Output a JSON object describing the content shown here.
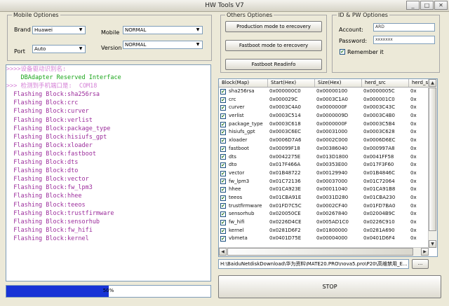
{
  "window": {
    "title": "HW Tools V7"
  },
  "mobile_options": {
    "legend": "Mobile Optiones",
    "brand_label": "Brand",
    "brand_value": "Huawei",
    "port_label": "Port",
    "port_value": "Auto",
    "mobile_label": "Mobile",
    "mobile_value": "NORMAL",
    "version_label": "Version",
    "version_value": "NORMAL"
  },
  "others_options": {
    "legend": "Others Optiones",
    "production_button": "Production mode to erecovery",
    "fastboot_button": "Fastboot mode to erecovery",
    "readinfo_button": "Fastboot Readinfo"
  },
  "id_pw_options": {
    "legend": "ID & PW Optiones",
    "account_label": "Account:",
    "account_value": "ARD",
    "password_label": "Password:",
    "password_value": "xxxxxxx",
    "remember_label": "Remember it",
    "remember_mark": "✔"
  },
  "log": {
    "lines": [
      {
        "text": ">>>>设备驱动识别名:",
        "color": "#d47fd6"
      },
      {
        "text": "    DBAdapter Reserved Interface",
        "color": "#19a519"
      },
      {
        "text": ">>> 检测到手机端口是:  COM18",
        "color": "#d47fd6"
      },
      {
        "text": "  Flashing Block:sha256rsa",
        "color": "#9b2c9b"
      },
      {
        "text": "  Flashing Block:crc",
        "color": "#9b2c9b"
      },
      {
        "text": "  Flashing Block:curver",
        "color": "#9b2c9b"
      },
      {
        "text": "  Flashing Block:verlist",
        "color": "#9b2c9b"
      },
      {
        "text": "  Flashing Block:package_type",
        "color": "#9b2c9b"
      },
      {
        "text": "  Flashing Block:hisiufs_gpt",
        "color": "#9b2c9b"
      },
      {
        "text": "  Flashing Block:xloader",
        "color": "#9b2c9b"
      },
      {
        "text": "  Flashing Block:fastboot",
        "color": "#9b2c9b"
      },
      {
        "text": "  Flashing Block:dts",
        "color": "#9b2c9b"
      },
      {
        "text": "  Flashing Block:dto",
        "color": "#9b2c9b"
      },
      {
        "text": "  Flashing Block:vector",
        "color": "#9b2c9b"
      },
      {
        "text": "  Flashing Block:fw_lpm3",
        "color": "#9b2c9b"
      },
      {
        "text": "  Flashing Block:hhee",
        "color": "#9b2c9b"
      },
      {
        "text": "  Flashing Block:teeos",
        "color": "#9b2c9b"
      },
      {
        "text": "  Flashing Block:trustfirmware",
        "color": "#9b2c9b"
      },
      {
        "text": "  Flashing Block:sensorhub",
        "color": "#9b2c9b"
      },
      {
        "text": "  Flashing Block:fw_hifi",
        "color": "#9b2c9b"
      },
      {
        "text": "  Flashing Block:kernel",
        "color": "#9b2c9b"
      }
    ]
  },
  "progress": {
    "value": 0.5,
    "label": "50%",
    "color": "#1833d6"
  },
  "table": {
    "headers": [
      "Block(Map)",
      "Start(Hex)",
      "Size(Hex)",
      "herd_src",
      "herd_sr"
    ],
    "check_mark": "✔",
    "rows": [
      [
        "sha256rsa",
        "0x000000C0",
        "0x00000100",
        "0x0000005C",
        "0x"
      ],
      [
        "crc",
        "0x000029C",
        "0x0003C1A0",
        "0x000001C0",
        "0x"
      ],
      [
        "curver",
        "0x0003C4A0",
        "0x0000000F",
        "0x0003C43C",
        "0x"
      ],
      [
        "verlist",
        "0x0003C514",
        "0x0000009D",
        "0x0003C4B0",
        "0x"
      ],
      [
        "package_type",
        "0x0003C618",
        "0x0000000F",
        "0x0003C5B4",
        "0x"
      ],
      [
        "hisiufs_gpt",
        "0x0003C6EC",
        "0x00031000",
        "0x0003C628",
        "0x"
      ],
      [
        "xloader",
        "0x0006D7A6",
        "0x0002C000",
        "0x0006D6EC",
        "0x"
      ],
      [
        "fastboot",
        "0x00099F18",
        "0x00386040",
        "0x000997A8",
        "0x"
      ],
      [
        "dts",
        "0x0042275E",
        "0x013D1800",
        "0x0041FF58",
        "0x"
      ],
      [
        "dto",
        "0x017F466A",
        "0x00353E00",
        "0x017F3F60",
        "0x"
      ],
      [
        "vector",
        "0x01B48722",
        "0x00129940",
        "0x01B4846C",
        "0x"
      ],
      [
        "fw_lpm3",
        "0x01C72136",
        "0x00037000",
        "0x01C72064",
        "0x"
      ],
      [
        "hhee",
        "0x01CA923E",
        "0x00011040",
        "0x01CA91B8",
        "0x"
      ],
      [
        "teeos",
        "0x01CBA91E",
        "0x0031D280",
        "0x01CBA230",
        "0x"
      ],
      [
        "trustfirmware",
        "0x01FD7C5C",
        "0x0002CF40",
        "0x01FD7BA0",
        "0x"
      ],
      [
        "sensorhub",
        "0x020050CE",
        "0x00267840",
        "0x02004B9C",
        "0x"
      ],
      [
        "fw_hifi",
        "0x0226D4CE",
        "0x005AD1C0",
        "0x0226C910",
        "0x"
      ],
      [
        "kernel",
        "0x0281D6F2",
        "0x01800000",
        "0x0281A690",
        "0x"
      ],
      [
        "vbmeta",
        "0x0401D75E",
        "0x00004000",
        "0x0401D6F4",
        "0x"
      ]
    ]
  },
  "path": {
    "value": "H:\\BaiduNetdiskDownload\\华为资料\\MATE20.PRO\\nova5.pro\\P20\\高维禁用_E...",
    "browse_label": "..."
  },
  "stop_button": "STOP",
  "icons": {
    "dropdown": "chevron-down-icon",
    "minimize": "minimize-icon",
    "maximize": "maximize-icon",
    "close": "close-icon"
  },
  "glyphs": {
    "down": "▼",
    "up": "▲",
    "left": "◀",
    "right": "▶",
    "min": "_",
    "max": "□",
    "close": "✕"
  }
}
